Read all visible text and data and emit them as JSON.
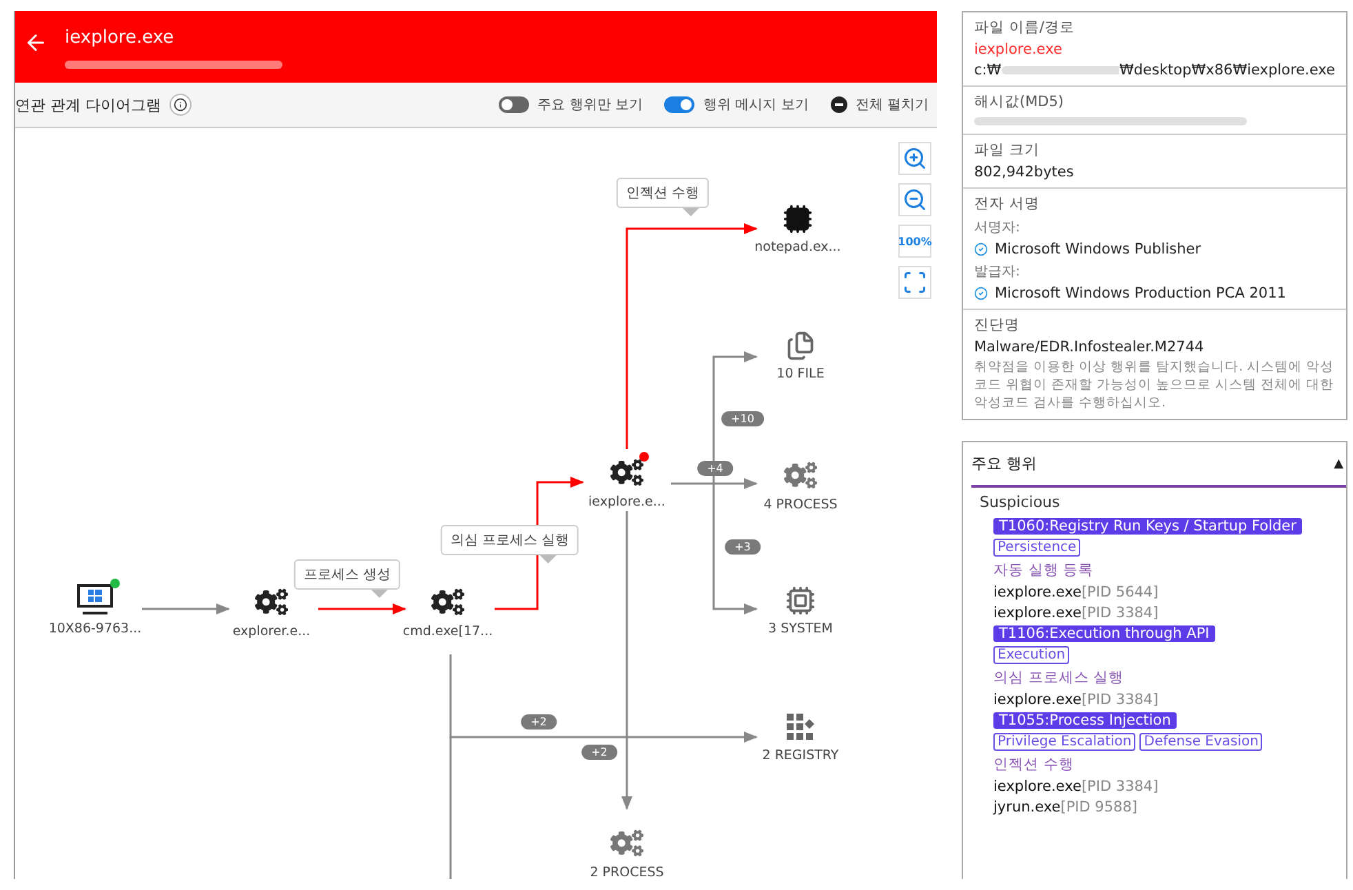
{
  "header": {
    "title": "iexplore.exe"
  },
  "toolbar": {
    "title": "연관 관계 다이어그램",
    "toggles": [
      {
        "label": "주요 행위만 보기",
        "on": false
      },
      {
        "label": "행위 메시지 보기",
        "on": true
      }
    ],
    "expand_button": "전체 펼치기"
  },
  "zoom_controls": {
    "reset": "100%"
  },
  "diagram": {
    "nodes": [
      {
        "kind": "host",
        "label": "10X86-9763...",
        "color": "#22bb44"
      },
      {
        "kind": "process",
        "label": "explorer.e..."
      },
      {
        "kind": "process",
        "label": "cmd.exe[17..."
      },
      {
        "kind": "process",
        "label": "iexplore.e...",
        "color": "#ff0000"
      },
      {
        "kind": "chip_dark",
        "label": "notepad.ex..."
      },
      {
        "kind": "file",
        "label": "10 FILE"
      },
      {
        "kind": "process_light",
        "label": "4 PROCESS"
      },
      {
        "kind": "chip",
        "label": "3 SYSTEM"
      },
      {
        "kind": "registry",
        "label": "2 REGISTRY"
      },
      {
        "kind": "process_light",
        "label": "2 PROCESS"
      }
    ],
    "edges": [
      {
        "kind": "normal"
      },
      {
        "kind": "alert",
        "callout": "프로세스 생성"
      },
      {
        "kind": "alert",
        "callout": "의심 프로세스 실행"
      },
      {
        "kind": "alert",
        "callout": "인젝션 수행"
      },
      {
        "kind": "normal",
        "badge": "+10"
      },
      {
        "kind": "normal",
        "badge": "+4"
      },
      {
        "kind": "normal",
        "badge": "+3"
      },
      {
        "kind": "normal",
        "badge": "+2"
      },
      {
        "kind": "normal",
        "badge": "+2"
      },
      {
        "kind": "normal"
      }
    ]
  },
  "file_info": [
    {
      "kind": "path",
      "label": "파일 이름/경로",
      "name": "iexplore.exe",
      "path_start": "c:₩",
      "path_end": "₩desktop₩x86₩iexplore.exe"
    },
    {
      "kind": "hash",
      "label": "해시값(MD5)"
    },
    {
      "kind": "plain",
      "label": "파일 크기",
      "value": "802,942bytes"
    },
    {
      "kind": "signature",
      "label": "전자 서명",
      "signer_label": "서명자:",
      "signer": "Microsoft Windows Publisher",
      "issuer_label": "발급자:",
      "issuer": "Microsoft Windows Production PCA 2011"
    },
    {
      "kind": "diagnosis",
      "label": "진단명",
      "value": "Malware/EDR.Infostealer.M2744",
      "description": "취약점을 이용한 이상 행위를 탐지했습니다. 시스템에 악성 코드 위협이 존재할 가능성이 높으므로 시스템 전체에 대한 악성코드 검사를 수행하십시오."
    }
  ],
  "behaviors": {
    "title": "주요 행위",
    "expanded": true,
    "toggle": "▲",
    "category": "Suspicious",
    "techniques": [
      {
        "technique": "T1060:Registry Run Keys / Startup Folder",
        "tactics": [
          "Persistence"
        ],
        "behavior": "자동 실행 등록",
        "processes": [
          {
            "name": "iexplore.exe",
            "pid": "[PID 5644]"
          },
          {
            "name": "iexplore.exe",
            "pid": "[PID 3384]"
          }
        ]
      },
      {
        "technique": "T1106:Execution through API",
        "tactics": [
          "Execution"
        ],
        "behavior": "의심 프로세스 실행",
        "processes": [
          {
            "name": "iexplore.exe",
            "pid": "[PID 3384]"
          }
        ]
      },
      {
        "technique": "T1055:Process Injection",
        "tactics": [
          "Privilege Escalation",
          "Defense Evasion"
        ],
        "behavior": "인젝션 수행",
        "processes": [
          {
            "name": "iexplore.exe",
            "pid": "[PID 3384]"
          },
          {
            "name": "jyrun.exe",
            "pid": "[PID 9588]"
          }
        ]
      }
    ]
  }
}
